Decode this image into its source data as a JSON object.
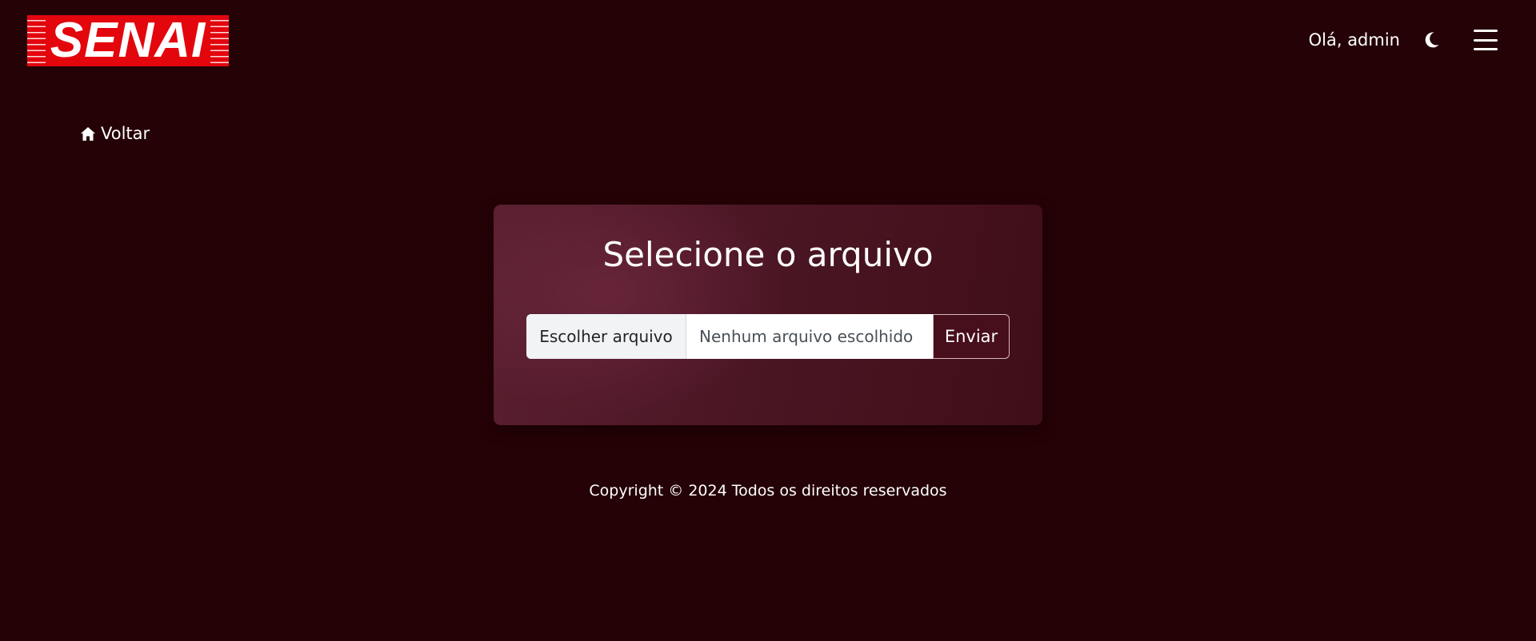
{
  "header": {
    "logo_text": "SENAI",
    "greeting": "Olá, admin",
    "theme_icon": "moon-icon",
    "menu_icon": "hamburger-menu-icon"
  },
  "nav": {
    "back_label": "Voltar",
    "back_icon": "home-icon"
  },
  "upload": {
    "title": "Selecione o arquivo",
    "choose_label": "Escolher arquivo",
    "no_file_label": "Nenhum arquivo escolhido",
    "submit_label": "Enviar"
  },
  "footer": {
    "copyright": "Copyright © 2024 Todos os direitos reservados"
  },
  "colors": {
    "background": "#250205",
    "logo_red": "#e3060d",
    "card": "#4d1726"
  }
}
